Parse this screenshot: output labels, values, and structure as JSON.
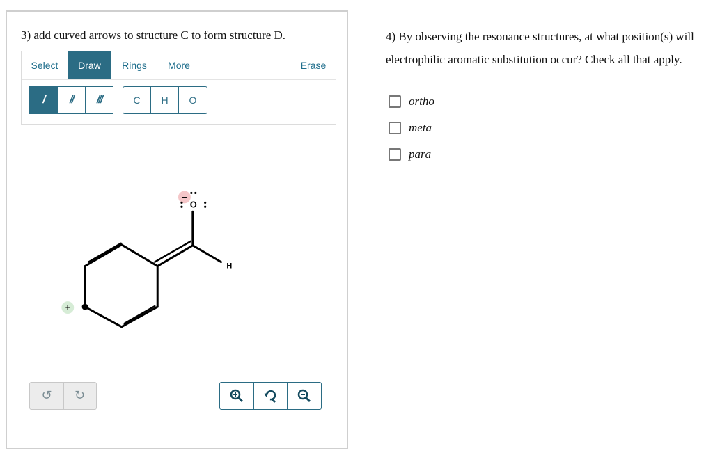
{
  "question3": {
    "title": "3) add curved arrows to structure C to form structure D.",
    "tabs": [
      "Select",
      "Draw",
      "Rings",
      "More"
    ],
    "active_tab": "Draw",
    "erase_label": "Erase",
    "bond_buttons": [
      {
        "label": "/",
        "icon": "single-bond-icon"
      },
      {
        "label": "//",
        "icon": "double-bond-icon"
      },
      {
        "label": "///",
        "icon": "triple-bond-icon"
      }
    ],
    "atom_buttons": [
      "C",
      "H",
      "O"
    ],
    "molecule": {
      "oxygen_label": "O",
      "oxygen_charge": "−",
      "hydrogen_label": "H",
      "carbocation_charge": "+"
    },
    "history_icons": [
      "undo-icon",
      "redo-icon"
    ],
    "zoom_icons": [
      "zoom-in-icon",
      "reset-zoom-icon",
      "zoom-out-icon"
    ]
  },
  "question4": {
    "prompt": "4) By observing the resonance structures, at what position(s) will electrophilic aromatic substitution occur? Check all that apply.",
    "options": [
      {
        "label": "ortho",
        "checked": false
      },
      {
        "label": "meta",
        "checked": false
      },
      {
        "label": "para",
        "checked": false
      }
    ]
  },
  "colors": {
    "accent": "#2b6c84",
    "charge_negative": "#f4c6c8",
    "charge_positive": "#d6ecd6"
  }
}
